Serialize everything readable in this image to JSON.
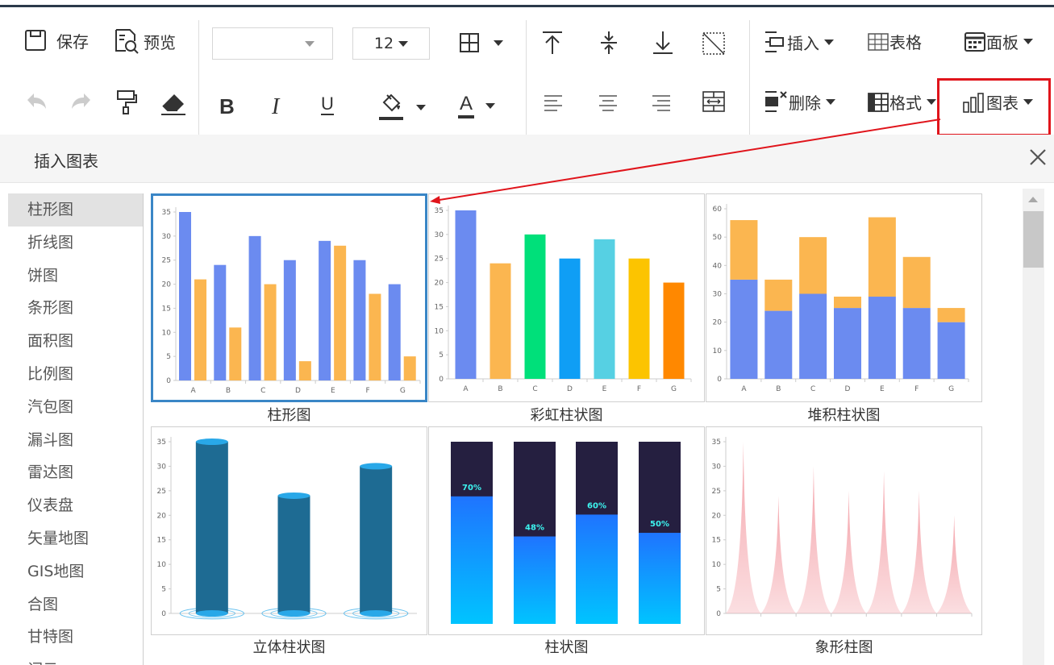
{
  "toolbar": {
    "save": "保存",
    "preview": "预览",
    "font_size": "12",
    "insert": "插入",
    "table": "表格",
    "panel": "面板",
    "delete": "删除",
    "format": "格式",
    "chart": "图表",
    "bold": "B",
    "italic": "I",
    "underline": "U",
    "font_color": "A"
  },
  "panel": {
    "title": "插入图表"
  },
  "sidebar": {
    "items": [
      "柱形图",
      "折线图",
      "饼图",
      "条形图",
      "面积图",
      "比例图",
      "汽包图",
      "漏斗图",
      "雷达图",
      "仪表盘",
      "矢量地图",
      "GIS地图",
      "合图",
      "甘特图",
      "词云"
    ],
    "selected": "柱形图"
  },
  "gallery": {
    "selected": "柱形图",
    "captions": [
      "柱形图",
      "彩虹柱状图",
      "堆积柱状图",
      "立体柱状图",
      "柱状图",
      "象形柱图"
    ]
  },
  "chart_data": [
    {
      "type": "bar",
      "categories": [
        "A",
        "B",
        "C",
        "D",
        "E",
        "F",
        "G"
      ],
      "series": [
        {
          "values": [
            35,
            24,
            30,
            25,
            29,
            25,
            20
          ]
        },
        {
          "values": [
            21,
            11,
            20,
            4,
            28,
            18,
            5
          ]
        }
      ],
      "yticks": [
        "0",
        "5",
        "10",
        "15",
        "20",
        "25",
        "30",
        "35"
      ],
      "ylim": [
        0,
        35
      ],
      "colors": [
        "#6b8bf0",
        "#fbb650"
      ]
    },
    {
      "type": "bar",
      "categories": [
        "A",
        "B",
        "C",
        "D",
        "E",
        "F",
        "G"
      ],
      "values": [
        35,
        24,
        30,
        25,
        29,
        25,
        20
      ],
      "yticks": [
        "0",
        "5",
        "10",
        "15",
        "20",
        "25",
        "30",
        "35"
      ],
      "ylim": [
        0,
        35
      ],
      "colors": [
        "#6b8bf0",
        "#fbb650",
        "#00e07a",
        "#0f9ef5",
        "#56d0e3",
        "#fcc400",
        "#ff8800"
      ]
    },
    {
      "type": "bar",
      "stacked": true,
      "categories": [
        "A",
        "B",
        "C",
        "D",
        "E",
        "F",
        "G"
      ],
      "series": [
        {
          "values": [
            35,
            24,
            30,
            25,
            29,
            25,
            20
          ]
        },
        {
          "values": [
            21,
            11,
            20,
            4,
            28,
            18,
            5
          ]
        }
      ],
      "yticks": [
        "0",
        "10",
        "20",
        "30",
        "40",
        "50",
        "60"
      ],
      "ylim": [
        0,
        60
      ],
      "colors": [
        "#6b8bf0",
        "#fbb650"
      ]
    },
    {
      "type": "bar",
      "variant": "3d-cylinder",
      "values": [
        35,
        24,
        30
      ],
      "yticks": [
        "0",
        "5",
        "10",
        "15",
        "20",
        "25",
        "30",
        "35"
      ],
      "ylim": [
        0,
        35
      ],
      "colors": [
        "#1e6b93",
        "#29a8e8"
      ]
    },
    {
      "type": "bar",
      "variant": "progress",
      "values": [
        70,
        48,
        60,
        50
      ],
      "labels": [
        "70%",
        "48%",
        "60%",
        "50%"
      ],
      "colors": [
        "#251f40",
        "#1f74ff",
        "#00c4ff",
        "#3df5f0"
      ]
    },
    {
      "type": "bar",
      "variant": "pictorial-spike",
      "values": [
        35,
        24,
        30,
        25,
        29,
        25,
        20
      ],
      "yticks": [
        "0",
        "5",
        "10",
        "15",
        "20",
        "25",
        "30",
        "35"
      ],
      "ylim": [
        0,
        35
      ],
      "colors": [
        "#f4a3aa"
      ]
    }
  ]
}
